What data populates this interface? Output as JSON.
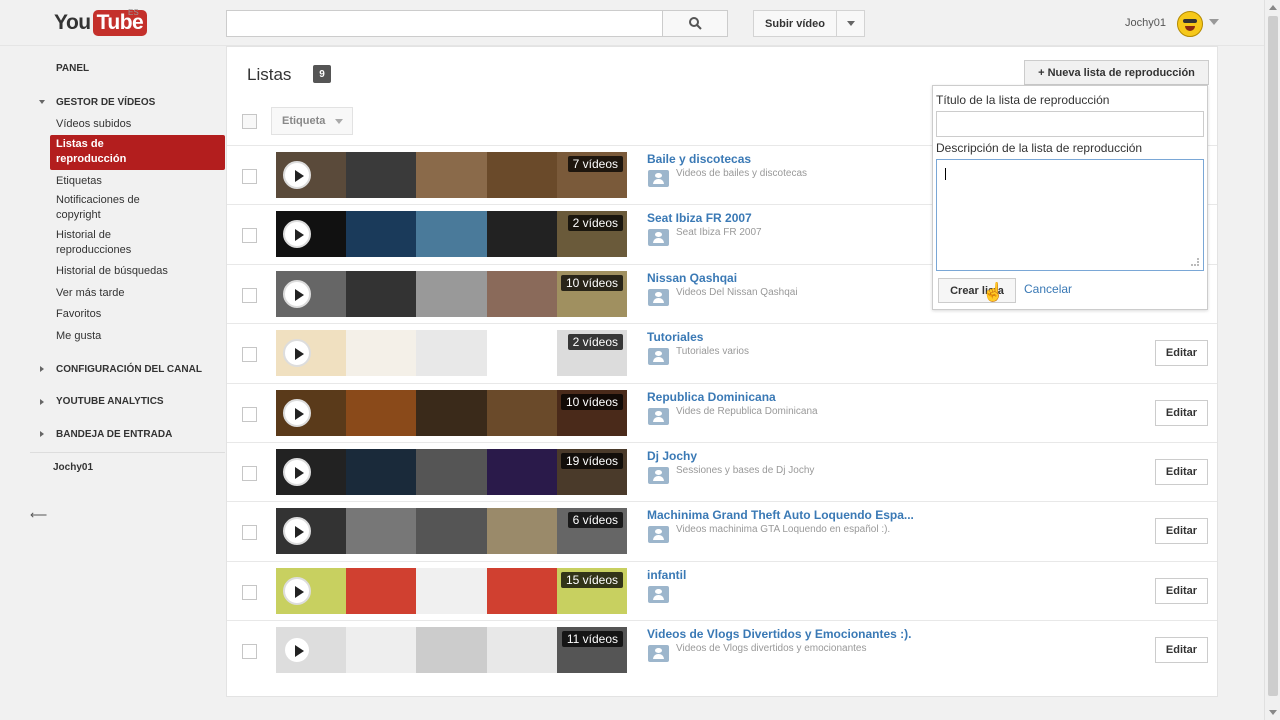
{
  "header": {
    "logo_you": "You",
    "logo_tube": "Tube",
    "logo_region": "ES",
    "search_placeholder": "",
    "upload_label": "Subir vídeo",
    "username": "Jochy01"
  },
  "sidebar": {
    "panel": "PANEL",
    "video_manager": "GESTOR DE VÍDEOS",
    "items": [
      "Vídeos subidos",
      "Listas de reproducción",
      "Etiquetas",
      "Notificaciones de copyright",
      "Historial de reproducciones",
      "Historial de búsquedas",
      "Ver más tarde",
      "Favoritos",
      "Me gusta"
    ],
    "channel_settings": "CONFIGURACIÓN DEL CANAL",
    "analytics": "YOUTUBE ANALYTICS",
    "inbox": "BANDEJA DE ENTRADA",
    "back_user": "Jochy01"
  },
  "main": {
    "title": "Listas",
    "count": "9",
    "tag_label": "Etiqueta",
    "new_list_label": "+ Nueva lista de reproducción",
    "edit_label": "Editar",
    "playlists": [
      {
        "title": "Baile y discotecas",
        "desc": "Videos de bailes y discotecas",
        "count": "7 vídeos",
        "colors": [
          "#5a4a3a",
          "#3a3a3a",
          "#8a6a4a",
          "#6a4a2a",
          "#7a5a3a"
        ]
      },
      {
        "title": "Seat Ibiza FR 2007",
        "desc": "Seat Ibiza FR 2007",
        "count": "2 vídeos",
        "colors": [
          "#111",
          "#1a3a5a",
          "#4a7a9a",
          "#222",
          "#6a5a3a"
        ]
      },
      {
        "title": "Nissan Qashqai",
        "desc": "Videos Del Nissan Qashqai",
        "count": "10 vídeos",
        "colors": [
          "#666",
          "#333",
          "#999",
          "#8a6a5a",
          "#a09060"
        ]
      },
      {
        "title": "Tutoriales",
        "desc": "Tutoriales varios",
        "count": "2 vídeos",
        "colors": [
          "#f0e0c0",
          "#f4f0e8",
          "#e8e8e8",
          "#ffffff",
          "#dcdcdc"
        ]
      },
      {
        "title": "Republica Dominicana",
        "desc": "Vides de Republica Dominicana",
        "count": "10 vídeos",
        "colors": [
          "#5a3a1a",
          "#8a4a1a",
          "#3a2a1a",
          "#6a4a2a",
          "#4a2a1a"
        ]
      },
      {
        "title": "Dj Jochy",
        "desc": "Sessiones y bases de Dj Jochy",
        "count": "19 vídeos",
        "colors": [
          "#222",
          "#1a2a3a",
          "#555",
          "#2a1a4a",
          "#4a3a2a"
        ]
      },
      {
        "title": "Machinima Grand Theft Auto Loquendo Espa...",
        "desc": "Videos machinima GTA Loquendo en español :).",
        "count": "6 vídeos",
        "colors": [
          "#333",
          "#777",
          "#555",
          "#9a8a6a",
          "#666"
        ]
      },
      {
        "title": "infantil",
        "desc": "",
        "count": "15 vídeos",
        "colors": [
          "#c8d060",
          "#d04030",
          "#f0f0f0",
          "#d04030",
          "#c8d060"
        ]
      },
      {
        "title": "Videos de Vlogs Divertidos y Emocionantes :).",
        "desc": "Videos de Vlogs divertidos y emocionantes",
        "count": "11 vídeos",
        "colors": [
          "#ddd",
          "#eee",
          "#ccc",
          "#e8e8e8",
          "#555"
        ]
      }
    ]
  },
  "popup": {
    "title_label": "Título de la lista de reproducción",
    "desc_label": "Descripción de la lista de reproducción",
    "create_label": "Crear lista",
    "cancel_label": "Cancelar"
  }
}
